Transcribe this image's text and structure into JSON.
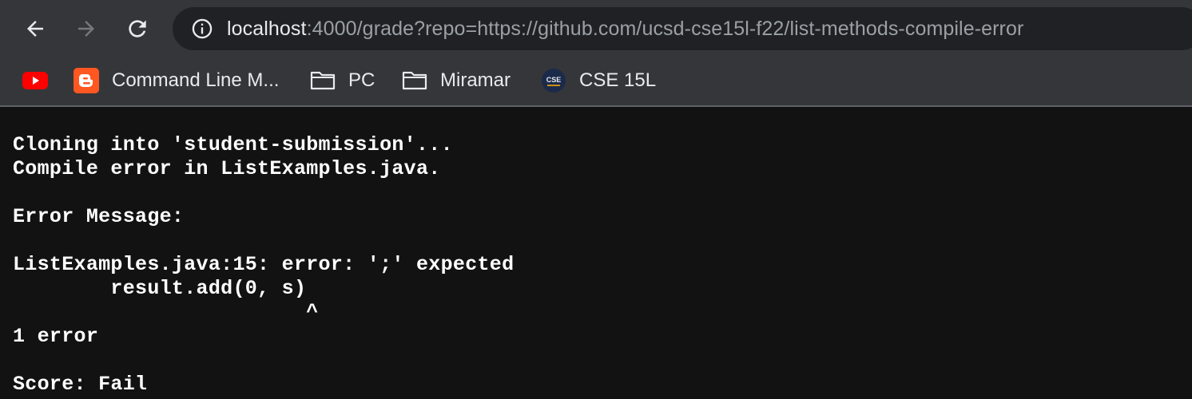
{
  "toolbar": {
    "back_icon": "arrow-left-icon",
    "forward_icon": "arrow-right-icon",
    "reload_icon": "reload-icon",
    "info_icon": "info-icon",
    "url_host": "localhost",
    "url_rest": ":4000/grade?repo=https://github.com/ucsd-cse15l-f22/list-methods-compile-error"
  },
  "bookmarks": [
    {
      "label": "",
      "icon": "youtube-icon",
      "color": "#ff0000"
    },
    {
      "label": "Command Line M...",
      "icon": "blogger-icon",
      "color": "#ff5722"
    },
    {
      "label": "PC",
      "icon": "folder-icon"
    },
    {
      "label": "Miramar",
      "icon": "folder-icon"
    },
    {
      "label": "CSE 15L",
      "icon": "cse-ucsd-icon",
      "icon_text": "CSE"
    }
  ],
  "output": {
    "text": "Cloning into 'student-submission'...\nCompile error in ListExamples.java.\n\nError Message:\n\nListExamples.java:15: error: ';' expected\n        result.add(0, s)\n                        ^\n1 error\n\nScore: Fail"
  },
  "colors": {
    "toolbar_bg": "#35363a",
    "omnibox_bg": "#202124",
    "page_bg": "#121212",
    "text_primary": "#e8eaed",
    "text_secondary": "#9aa0a6"
  }
}
